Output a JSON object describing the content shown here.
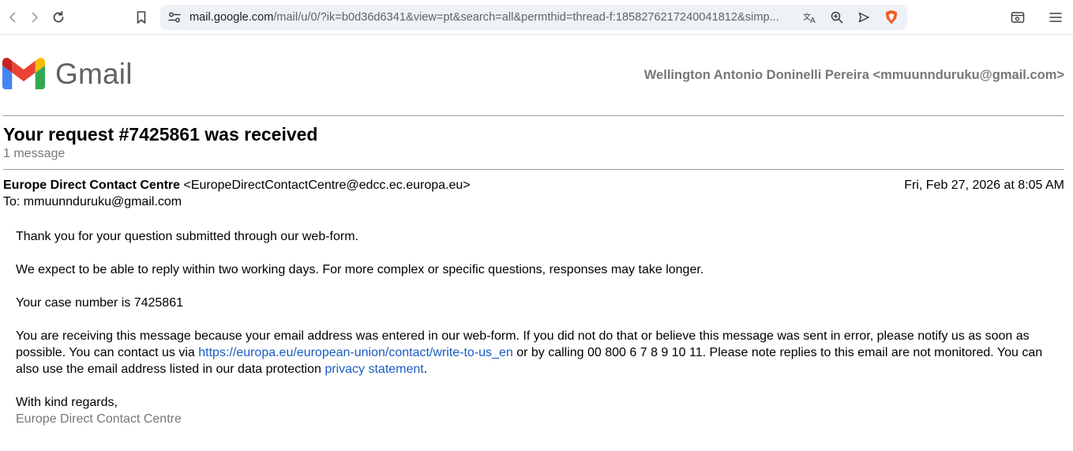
{
  "browser": {
    "url_host": "mail.google.com",
    "url_rest": "/mail/u/0/?ik=b0d36d6341&view=pt&search=all&permthid=thread-f:1858276217240041812&simp..."
  },
  "gmail": {
    "wordmark": "Gmail",
    "account": "Wellington Antonio Doninelli Pereira <mmuunnduruku@gmail.com>"
  },
  "thread": {
    "subject": "Your request #7425861 was received",
    "message_count": "1 message"
  },
  "message": {
    "sender_name": "Europe Direct Contact Centre",
    "sender_email": "<EuropeDirectContactCentre@edcc.ec.europa.eu>",
    "date": "Fri, Feb 27, 2026 at 8:05 AM",
    "to": "To: mmuunnduruku@gmail.com",
    "body": {
      "p1": "Thank you for your question submitted through our web-form.",
      "p2": "We expect to be able to reply within two working days. For more complex or specific questions, responses may take longer.",
      "p3": "Your case number is 7425861",
      "p4_a": "You are receiving this message because your email address was entered in our web-form. If you did not do that or believe this message was sent in error, please notify us as soon as possible. You can contact us via ",
      "p4_link1": "https://europa.eu/european-union/contact/write-to-us_en",
      "p4_b": " or by calling 00 800 6 7 8 9 10 11. Please note replies to this email are not monitored. You can also use the email address listed in our data protection ",
      "p4_link2": "privacy statement",
      "p4_c": ".",
      "closing": "With kind regards,",
      "signature": "Europe Direct Contact Centre"
    }
  },
  "icons": [
    "back-icon",
    "forward-icon",
    "reload-icon",
    "bookmark-icon",
    "site-settings-icon",
    "translate-icon",
    "zoom-icon",
    "send-icon",
    "brave-shield-icon",
    "tab-icon",
    "menu-icon"
  ],
  "colors": {
    "link": "#1a5bc4",
    "brave": "#f25a22"
  }
}
